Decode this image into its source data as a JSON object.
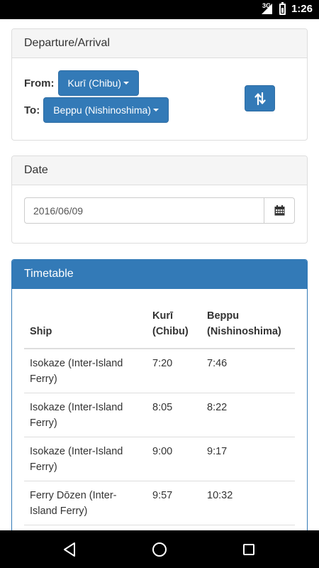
{
  "status_bar": {
    "network": "3G",
    "time": "1:26",
    "icons": [
      "signal-icon",
      "battery-icon"
    ]
  },
  "departure_arrival": {
    "title": "Departure/Arrival",
    "from_label": "From:",
    "from_value": "Kurī (Chibu)",
    "to_label": "To:",
    "to_value": "Beppu (Nishinoshima)",
    "swap_icon": "swap-arrows-icon"
  },
  "date_panel": {
    "title": "Date",
    "value": "2016/06/09",
    "calendar_icon": "calendar-icon"
  },
  "timetable": {
    "title": "Timetable",
    "headers": {
      "ship": "Ship",
      "from": "Kurī (Chibu)",
      "to": "Beppu (Nishinoshima)"
    },
    "rows": [
      {
        "ship": "Isokaze (Inter-Island Ferry)",
        "depart": "7:20",
        "arrive": "7:46"
      },
      {
        "ship": "Isokaze (Inter-Island Ferry)",
        "depart": "8:05",
        "arrive": "8:22"
      },
      {
        "ship": "Isokaze (Inter-Island Ferry)",
        "depart": "9:00",
        "arrive": "9:17"
      },
      {
        "ship": "Ferry Dōzen (Inter-Island Ferry)",
        "depart": "9:57",
        "arrive": "10:32"
      }
    ]
  },
  "nav_bar": {
    "icons": [
      "back-icon",
      "home-icon",
      "recents-icon"
    ]
  },
  "colors": {
    "primary": "#337ab7",
    "panel_heading_bg": "#f5f5f5",
    "border": "#dddddd"
  }
}
